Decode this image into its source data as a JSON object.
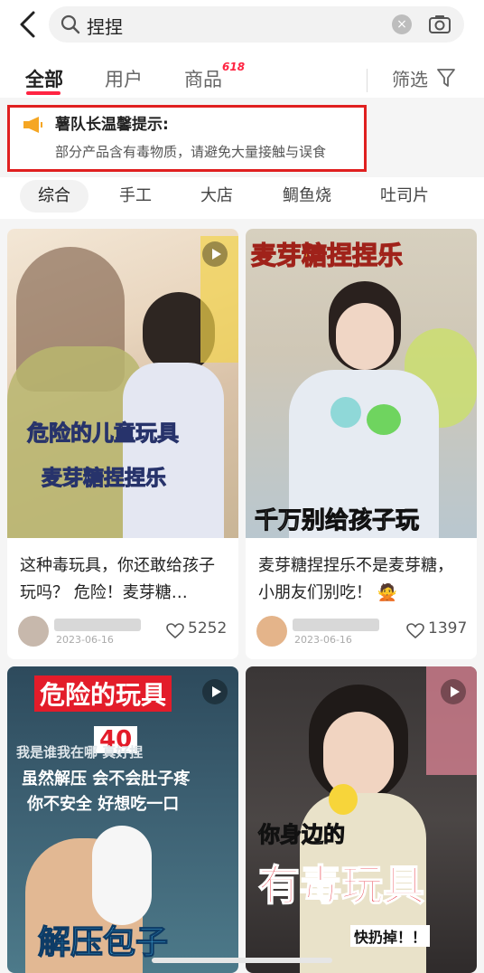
{
  "search": {
    "query": "捏捏"
  },
  "tabs": [
    {
      "label": "全部",
      "active": true
    },
    {
      "label": "用户"
    },
    {
      "label": "商品",
      "badge": "618"
    }
  ],
  "filter": {
    "label": "筛选"
  },
  "notice": {
    "title": "薯队长温馨提示:",
    "text": "部分产品含有毒物质，请避免大量接触与误食"
  },
  "chips": [
    "综合",
    "手工",
    "大店",
    "鲷鱼烧",
    "吐司片"
  ],
  "cards": [
    {
      "overlay_lines": [
        "危险的儿童玩具",
        "麦芽糖捏捏乐"
      ],
      "title": "这种毒玩具，你还敢给孩子玩吗？ 危险！麦芽糖…",
      "date": "2023-06-16",
      "likes": "5252"
    },
    {
      "overlay_top": "麦芽糖捏捏乐",
      "overlay_bottom": "千万别给孩子玩",
      "title": "麦芽糖捏捏乐不是麦芽糖，小朋友们别吃！ 🙅",
      "date": "2023-06-16",
      "likes": "1397"
    },
    {
      "overlay_lines": [
        "危险的玩具",
        "40",
        "我是谁我在哪 真好捏",
        "虽然解压 会不会肚子疼",
        "你不安全 好想吃一口",
        "解压包子"
      ]
    },
    {
      "overlay_lines": [
        "你身边的",
        "有毒玩具",
        "快扔掉！！"
      ]
    }
  ],
  "colors": {
    "accent": "#ff2442",
    "notice_border": "#e02020"
  }
}
